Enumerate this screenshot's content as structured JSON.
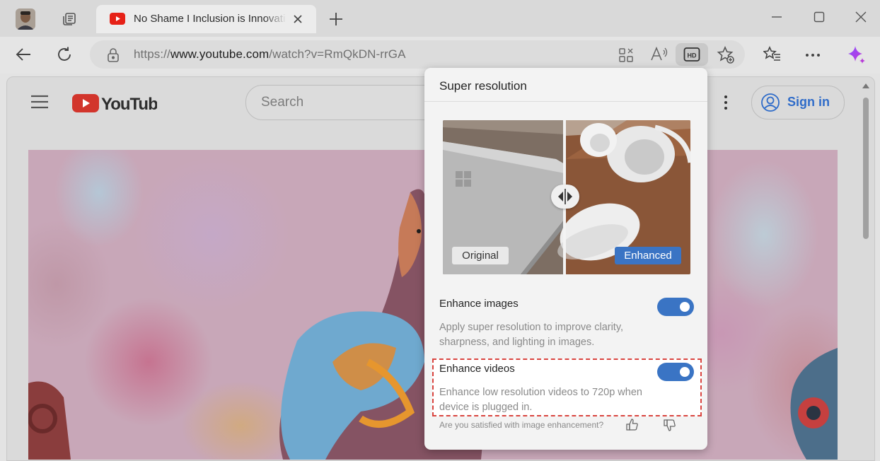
{
  "browser": {
    "tab": {
      "title": "No Shame I Inclusion is Innovation",
      "favicon": "youtube-icon",
      "close_icon": "close-icon"
    },
    "new_tab_icon": "plus-icon",
    "window_controls": [
      "minimize-icon",
      "maximize-icon",
      "close-icon"
    ],
    "nav": {
      "back": "back-icon",
      "refresh": "refresh-icon"
    },
    "address": {
      "prefix": "https://",
      "domain": "www.youtube.com",
      "path": "/watch?v=RmQkDN-rrGA",
      "lock_icon": "lock-icon"
    },
    "toolbar_icons": [
      "apps-icon",
      "read-aloud-icon",
      "hd-icon",
      "favorite-add-icon",
      "favorites-icon",
      "more-icon",
      "copilot-icon"
    ],
    "accent": "#3a74c4"
  },
  "youtube": {
    "logo_text": "YouTube",
    "search_placeholder": "Search",
    "sign_in_label": "Sign in",
    "brand_red": "#e62117"
  },
  "popup": {
    "title": "Super resolution",
    "compare": {
      "original_label": "Original",
      "enhanced_label": "Enhanced"
    },
    "enhance_images": {
      "label": "Enhance images",
      "description": "Apply super resolution to improve clarity, sharpness, and lighting in images.",
      "enabled": true
    },
    "enhance_videos": {
      "label": "Enhance videos",
      "description": "Enhance low resolution videos to 720p when device is plugged in.",
      "enabled": true
    },
    "feedback": {
      "question": "Are you satisfied with image enhancement?",
      "like_icon": "thumbs-up-icon",
      "dislike_icon": "thumbs-down-icon"
    }
  }
}
